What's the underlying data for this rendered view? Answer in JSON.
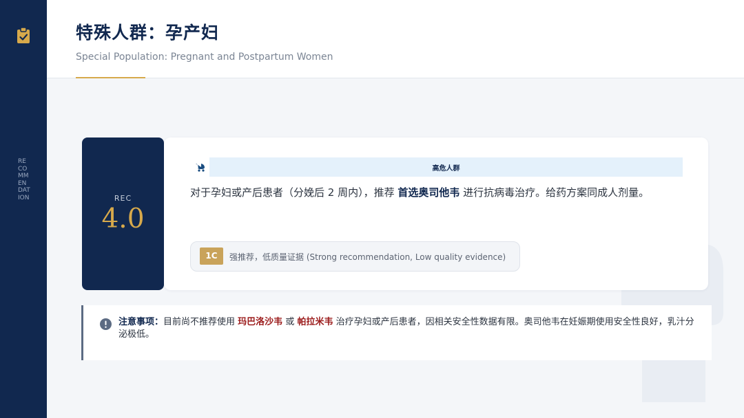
{
  "sidebar": {
    "vertical_text": "RECOMMENDATION",
    "icon": "clipboard-check-icon"
  },
  "header": {
    "title": "特殊人群：孕产妇",
    "subtitle": "Special Population: Pregnant and Postpartum Women"
  },
  "rec": {
    "label": "REC",
    "number": "4.0"
  },
  "tag": {
    "icon": "baby-carriage-icon",
    "text": "高危人群"
  },
  "statement": {
    "before": "对于孕妇或产后患者（分娩后 2 周内），推荐",
    "drug": "首选奥司他韦",
    "after": "进行抗病毒治疗。给药方案同成人剂量。"
  },
  "grade": {
    "badge": "1C",
    "text": "强推荐，低质量证据 (Strong recommendation, Low quality evidence)"
  },
  "note": {
    "icon": "exclamation-circle-icon",
    "label": "注意事项：",
    "part1": "目前尚不推荐使用",
    "drug1": "玛巴洛沙韦",
    "conj": "或",
    "drug2": "帕拉米韦",
    "part2": "治疗孕妇或产后患者，因相关安全性数据有限。奥司他韦在妊娠期使用安全性良好，乳汁分泌极低。"
  },
  "colors": {
    "navy": "#11284f",
    "gold": "#d7a94b",
    "tag_bg": "#e4f1fb",
    "warning_red": "#9b1b1b"
  }
}
